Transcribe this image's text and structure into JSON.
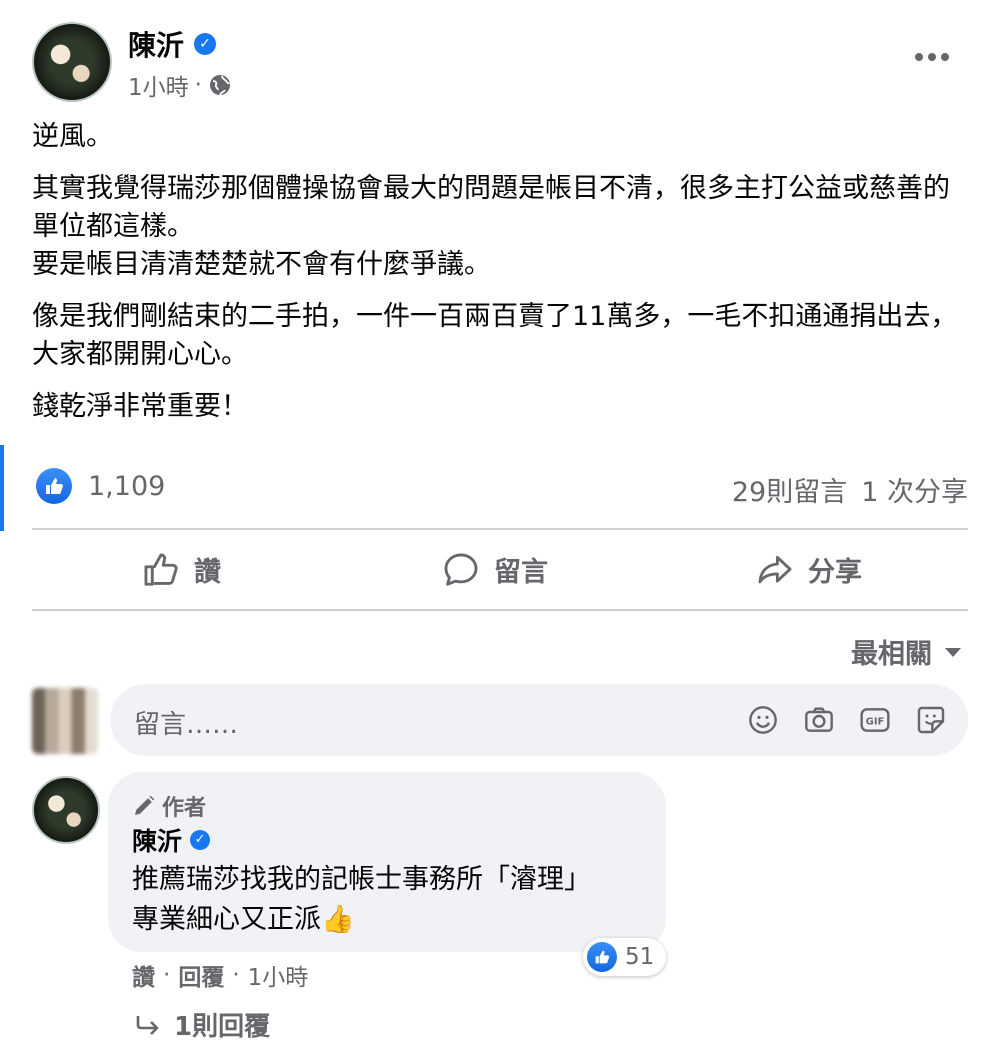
{
  "post": {
    "author": "陳沂",
    "time": "1小時",
    "paragraphs": [
      "逆風。",
      "其實我覺得瑞莎那個體操協會最大的問題是帳目不清，很多主打公益或慈善的單位都這樣。",
      "要是帳目清清楚楚就不會有什麼爭議。",
      "像是我們剛結束的二手拍，一件一百兩百賣了11萬多，一毛不扣通通捐出去，大家都開開心心。",
      "錢乾淨非常重要！"
    ],
    "like_count": "1,109",
    "comments_count": "29則留言",
    "shares_count": "1 次分享"
  },
  "actions": {
    "like": "讚",
    "comment": "留言",
    "share": "分享"
  },
  "sort": {
    "label": "最相關"
  },
  "comment_input": {
    "placeholder": "留言……"
  },
  "comment": {
    "author_badge": "作者",
    "author": "陳沂",
    "text_line1": "推薦瑞莎找我的記帳士事務所「濬理」",
    "text_line2": "專業細心又正派👍",
    "reaction_count": "51",
    "like": "讚",
    "reply": "回覆",
    "time": "1小時",
    "replies": "1則回覆"
  },
  "colors": {
    "accent": "#1877f2",
    "secondary_text": "#65676b",
    "bubble": "#f0f2f5"
  }
}
